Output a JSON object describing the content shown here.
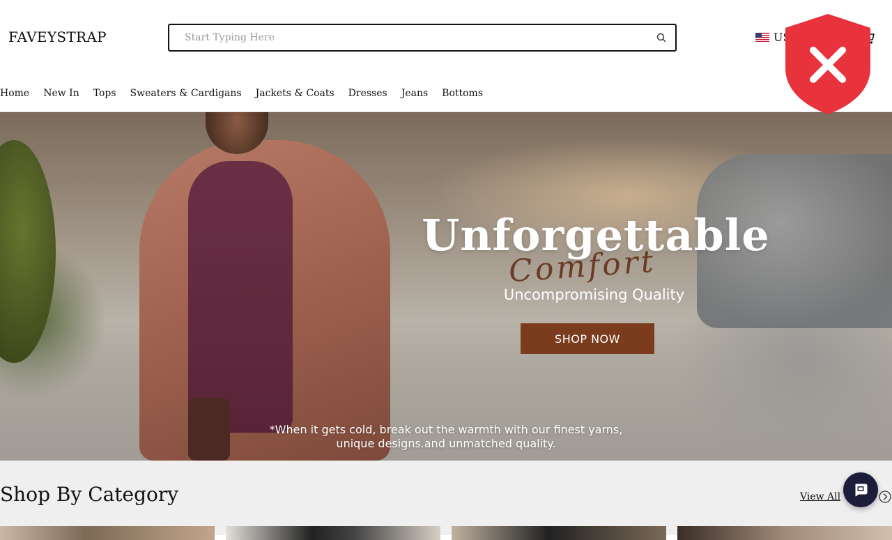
{
  "header": {
    "logo": "FAVEYSTRAP",
    "search": {
      "placeholder": "Start Typing Here",
      "value": ""
    },
    "currency": {
      "label": "US",
      "flag_icon": "us-flag-icon"
    },
    "cart_icon": "cart-icon",
    "nav": [
      {
        "label": "Home"
      },
      {
        "label": "New In"
      },
      {
        "label": "Tops"
      },
      {
        "label": "Sweaters & Cardigans"
      },
      {
        "label": "Jackets & Coats"
      },
      {
        "label": "Dresses"
      },
      {
        "label": "Jeans"
      },
      {
        "label": "Bottoms"
      }
    ]
  },
  "overlay": {
    "icon": "security-blocked-shield-icon",
    "color": "#e8323c"
  },
  "hero": {
    "title": "Unforgettable",
    "script": "Comfort",
    "subtitle": "Uncompromising Quality",
    "cta_label": "SHOP NOW",
    "cta_color": "#7a3c1c",
    "caption_line1": "*When it gets cold, break out the warmth with our finest yarns,",
    "caption_line2": "unique designs.and unmatched quality."
  },
  "category": {
    "title": "Shop By Category",
    "view_all": "View All",
    "next_icon": "chevron-right-circle-icon",
    "chat_icon": "chat-bubble-icon"
  }
}
